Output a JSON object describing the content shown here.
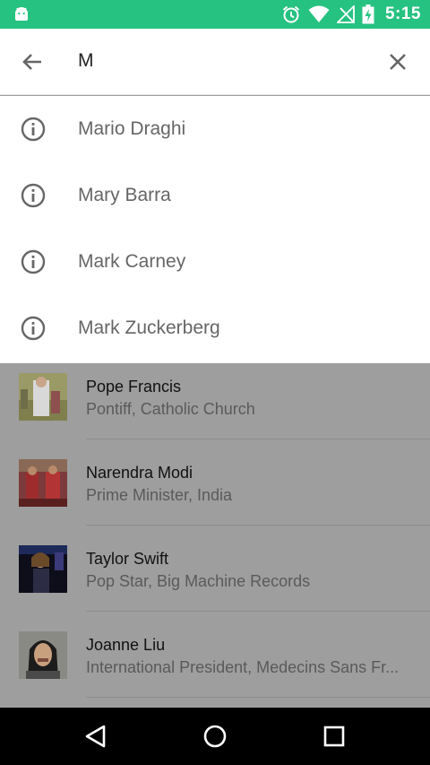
{
  "status_bar": {
    "time": "5:15",
    "background": "#26c281",
    "icons": [
      "android-icon",
      "alarm-icon",
      "wifi-icon",
      "no-signal-icon",
      "battery-charging-icon"
    ]
  },
  "search": {
    "query": "M",
    "back_icon": "arrow-back-icon",
    "clear_icon": "close-icon"
  },
  "suggestions": [
    {
      "label": "Mario Draghi",
      "icon": "info-icon"
    },
    {
      "label": "Mary Barra",
      "icon": "info-icon"
    },
    {
      "label": "Mark Carney",
      "icon": "info-icon"
    },
    {
      "label": "Mark Zuckerberg",
      "icon": "info-icon"
    }
  ],
  "results": [
    {
      "name": "Pope Francis",
      "subtitle": "Pontiff, Catholic Church"
    },
    {
      "name": "Narendra Modi",
      "subtitle": "Prime Minister, India"
    },
    {
      "name": "Taylor Swift",
      "subtitle": "Pop Star, Big Machine Records"
    },
    {
      "name": "Joanne Liu",
      "subtitle": "International President, Medecins Sans Fr..."
    }
  ],
  "nav_bar": {
    "buttons": [
      "back-triangle-icon",
      "home-circle-icon",
      "recents-square-icon"
    ]
  }
}
